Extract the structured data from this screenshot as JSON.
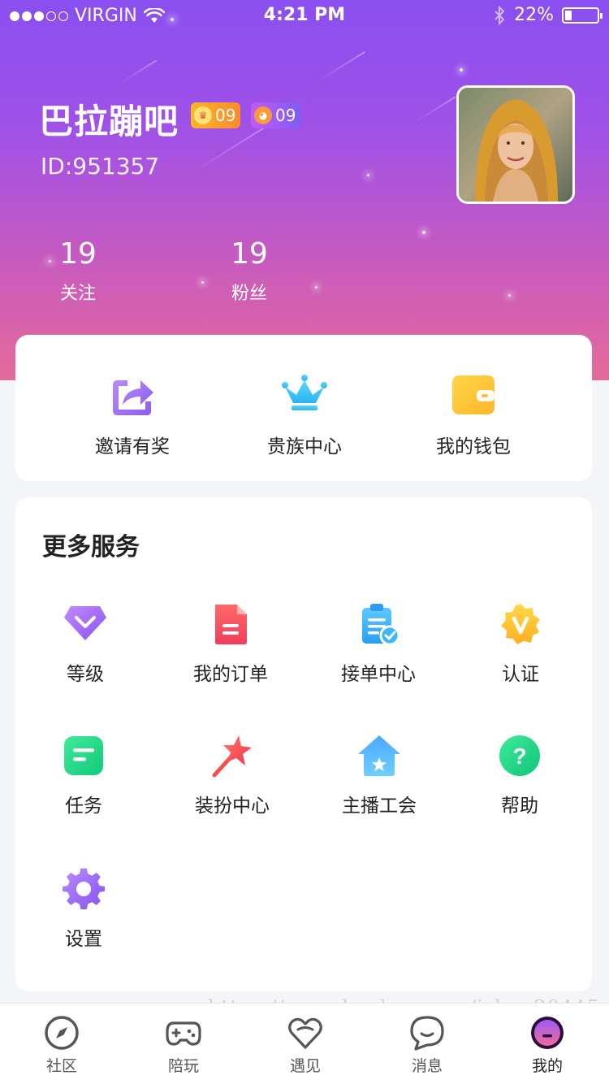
{
  "status_bar": {
    "carrier": "VIRGIN",
    "time": "4:21 PM",
    "battery_text": "22%",
    "battery_level": 0.22,
    "signal_bars": 3
  },
  "profile": {
    "name": "巴拉蹦吧",
    "badge_wealth": "09",
    "badge_charm": "09",
    "id_text": "ID:951357",
    "stats": [
      {
        "value": "19",
        "label": "关注"
      },
      {
        "value": "19",
        "label": "粉丝"
      }
    ]
  },
  "quick_actions": [
    {
      "label": "邀请有奖",
      "icon": "share-icon"
    },
    {
      "label": "贵族中心",
      "icon": "crown-icon"
    },
    {
      "label": "我的钱包",
      "icon": "wallet-icon"
    }
  ],
  "services": {
    "title": "更多服务",
    "items": [
      {
        "label": "等级",
        "icon": "diamond-level-icon"
      },
      {
        "label": "我的订单",
        "icon": "order-document-icon"
      },
      {
        "label": "接单中心",
        "icon": "clipboard-check-icon"
      },
      {
        "label": "认证",
        "icon": "verified-v-badge-icon"
      },
      {
        "label": "任务",
        "icon": "task-icon"
      },
      {
        "label": "装扮中心",
        "icon": "magic-wand-star-icon"
      },
      {
        "label": "主播工会",
        "icon": "house-star-icon"
      },
      {
        "label": "帮助",
        "icon": "help-question-icon"
      },
      {
        "label": "设置",
        "icon": "gear-icon"
      }
    ]
  },
  "watermark": "https://www.huzhan.com/ishop20445",
  "tab_bar": {
    "active": "我的",
    "tabs": [
      {
        "label": "社区",
        "icon": "compass-icon"
      },
      {
        "label": "陪玩",
        "icon": "gamepad-icon"
      },
      {
        "label": "遇见",
        "icon": "heart-icon"
      },
      {
        "label": "消息",
        "icon": "chat-bubble-icon"
      },
      {
        "label": "我的",
        "icon": "profile-avatar-icon"
      }
    ]
  },
  "colors": {
    "header_top": "#8a4ff0",
    "header_bottom": "#e56a9a",
    "accent_purple": "#9b6cf5",
    "page_bg": "#f4f5f9"
  }
}
